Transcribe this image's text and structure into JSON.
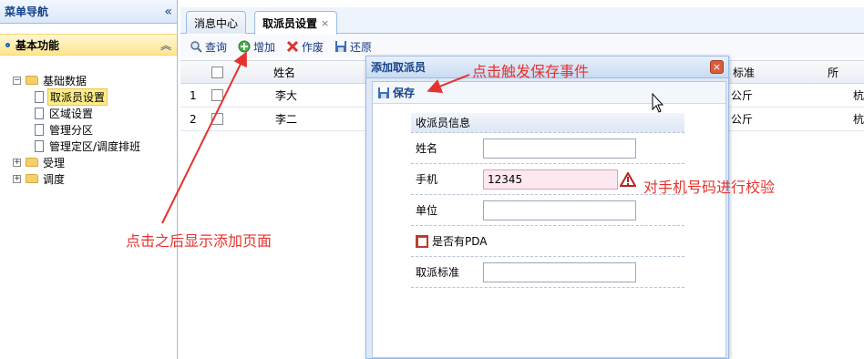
{
  "menu": {
    "title": "菜单导航",
    "collapse_icon": "«",
    "group_label": "基本功能",
    "group_toggle": "︽",
    "tree": {
      "root": "基础数据",
      "children": [
        "取派员设置",
        "区域设置",
        "管理分区",
        "管理定区/调度排班"
      ],
      "selected": "取派员设置",
      "siblings": [
        "受理",
        "调度"
      ]
    }
  },
  "tabs": [
    {
      "label": "消息中心",
      "active": false
    },
    {
      "label": "取派员设置",
      "active": true,
      "close": "×"
    }
  ],
  "toolbar": {
    "query": "查询",
    "add": "增加",
    "delete": "作废",
    "restore": "还原"
  },
  "grid": {
    "columns": [
      "姓名",
      "标准",
      "所"
    ],
    "rows": [
      {
        "num": "1",
        "name": "李大",
        "std": "公斤",
        "org": "杭"
      },
      {
        "num": "2",
        "name": "李二",
        "std": "公斤",
        "org": "杭"
      }
    ]
  },
  "modal": {
    "title": "添加取派员",
    "close": "×",
    "save_label": "保存",
    "form_caption": "收派员信息",
    "fields": {
      "name_label": "姓名",
      "name_value": "",
      "phone_label": "手机",
      "phone_value": "12345",
      "unit_label": "单位",
      "unit_value": "",
      "pda_label": "是否有PDA",
      "std_label": "取派标准",
      "std_value": ""
    }
  },
  "annotations": {
    "save_note": "点击触发保存事件",
    "phone_note": "对手机号码进行校验",
    "add_note": "点击之后显示添加页面",
    "color": "#e5322d"
  },
  "colors": {
    "accent": "#15428b",
    "border": "#99bbe8",
    "group_bg": "#ffe58f",
    "invalid_bg": "#fde8ef"
  }
}
